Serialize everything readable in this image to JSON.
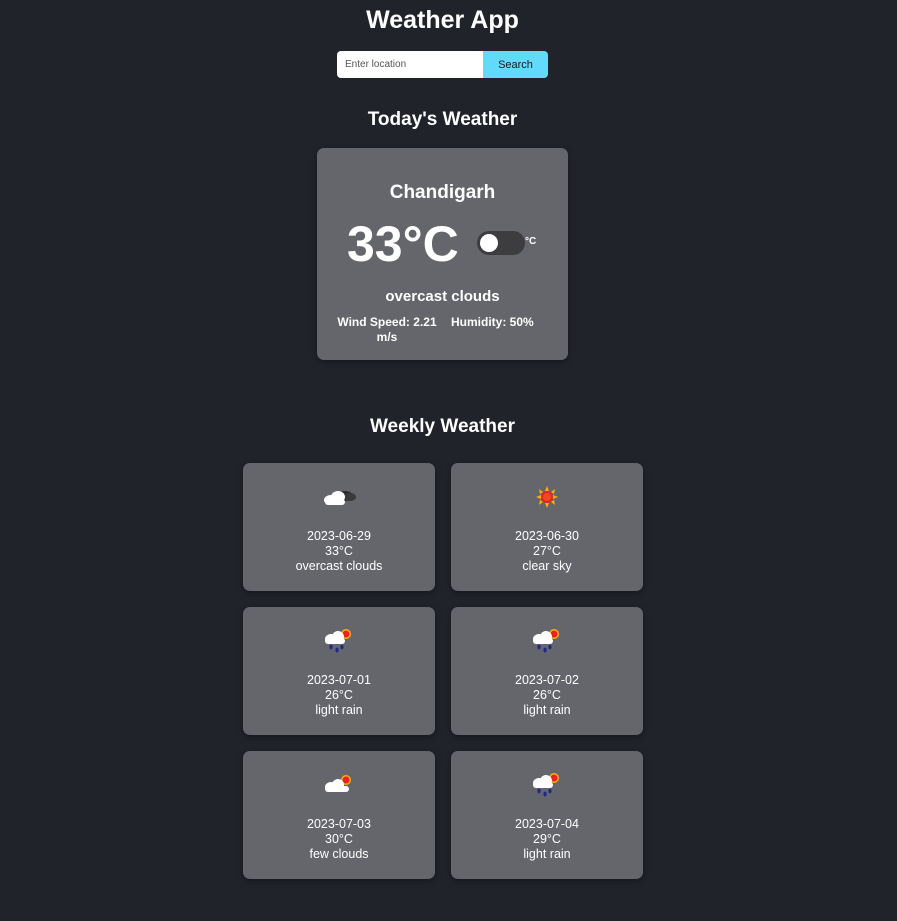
{
  "header": {
    "title": "Weather App"
  },
  "search": {
    "placeholder": "Enter location",
    "value": "",
    "button_label": "Search"
  },
  "today": {
    "heading": "Today's Weather",
    "city": "Chandigarh",
    "temperature": "33°C",
    "toggle_unit": "°C",
    "condition": "overcast clouds",
    "wind_speed": "Wind Speed: 2.21 m/s",
    "humidity": "Humidity: 50%"
  },
  "weekly": {
    "heading": "Weekly Weather",
    "days": [
      {
        "date": "2023-06-29",
        "temp": "33°C",
        "description": "overcast clouds",
        "icon": "overcast-clouds-icon"
      },
      {
        "date": "2023-06-30",
        "temp": "27°C",
        "description": "clear sky",
        "icon": "clear-sky-sun-icon"
      },
      {
        "date": "2023-07-01",
        "temp": "26°C",
        "description": "light rain",
        "icon": "light-rain-icon"
      },
      {
        "date": "2023-07-02",
        "temp": "26°C",
        "description": "light rain",
        "icon": "light-rain-icon"
      },
      {
        "date": "2023-07-03",
        "temp": "30°C",
        "description": "few clouds",
        "icon": "few-clouds-icon"
      },
      {
        "date": "2023-07-04",
        "temp": "29°C",
        "description": "light rain",
        "icon": "light-rain-icon"
      }
    ]
  },
  "colors": {
    "background": "#21232a",
    "card": "#65666b",
    "accent": "#61dafb",
    "text": "#ffffff"
  }
}
